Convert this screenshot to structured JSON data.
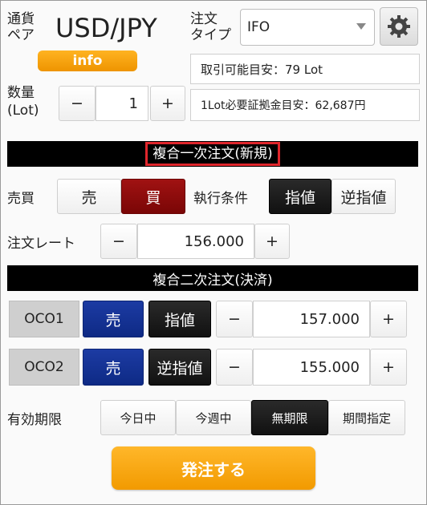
{
  "header": {
    "pair_label": "通貨\nペア",
    "pair": "USD/JPY",
    "order_type_label": "注文\nタイプ",
    "order_type_value": "IFO",
    "info_label": "info",
    "tradable_estimate": "取引可能目安：79 Lot",
    "margin_estimate": "1Lot必要証拠金目安：62,687円"
  },
  "quantity": {
    "label": "数量\n(Lot)",
    "minus": "−",
    "value": "1",
    "plus": "+"
  },
  "section1": {
    "title": "複合一次注文(新規)"
  },
  "trade": {
    "label": "売買",
    "sell": "売",
    "buy": "買",
    "condition_label": "執行条件",
    "limit": "指値",
    "stop": "逆指値"
  },
  "rate": {
    "label": "注文レート",
    "minus": "−",
    "value": "156.000",
    "plus": "+"
  },
  "section2": {
    "title": "複合二次注文(決済)"
  },
  "oco1": {
    "label": "OCO1",
    "side": "売",
    "type": "指値",
    "minus": "−",
    "value": "157.000",
    "plus": "+"
  },
  "oco2": {
    "label": "OCO2",
    "side": "売",
    "type": "逆指値",
    "minus": "−",
    "value": "155.000",
    "plus": "+"
  },
  "expiry": {
    "label": "有効期限",
    "options": [
      "今日中",
      "今週中",
      "無期限",
      "期間指定"
    ],
    "selected": "無期限"
  },
  "submit": {
    "label": "発注する"
  },
  "colors": {
    "buy_red": "#8b0a0a",
    "sell_blue": "#14308f",
    "submit_orange": "#f5a200",
    "highlight_border": "#e0262c"
  },
  "icons": {
    "settings": "gear-icon",
    "dropdown": "chevron-down-icon"
  }
}
